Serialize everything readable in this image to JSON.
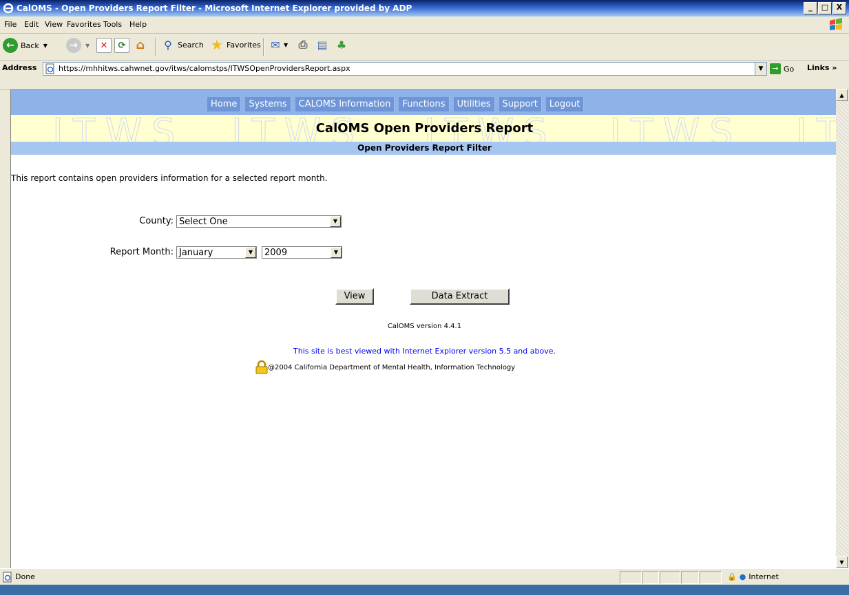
{
  "window": {
    "title": "CalOMS - Open Providers Report Filter - Microsoft Internet Explorer provided by ADP",
    "controls": [
      "_",
      "□",
      "X"
    ]
  },
  "menu": [
    "File",
    "Edit",
    "View",
    "Favorites",
    "Tools",
    "Help"
  ],
  "toolbar": {
    "back": "Back",
    "search": "Search",
    "favorites": "Favorites"
  },
  "address": {
    "label": "Address",
    "url": "https://mhhitws.cahwnet.gov/itws/calomstps/ITWSOpenProvidersReport.aspx",
    "go": "Go",
    "links": "Links"
  },
  "nav": [
    "Home",
    "Systems",
    "CALOMS Information",
    "Functions",
    "Utilities",
    "Support",
    "Logout"
  ],
  "banner": {
    "watermark": "ITWS",
    "title": "CalOMS Open Providers Report",
    "subtitle": "Open Providers Report Filter"
  },
  "main": {
    "description": "This report contains open providers information for a selected report month.",
    "county_label": "County:",
    "county_value": "Select One",
    "month_label": "Report Month:",
    "month_value": "January",
    "year_value": "2009",
    "view_button": "View",
    "extract_button": "Data Extract",
    "version": "CalOMS version 4.4.1",
    "best_viewed": "This site is best viewed with Internet Explorer version 5.5 and above.",
    "copyright": "@2004 California Department of Mental Health, Information Technology"
  },
  "status": {
    "text": "Done",
    "zone": "Internet"
  }
}
